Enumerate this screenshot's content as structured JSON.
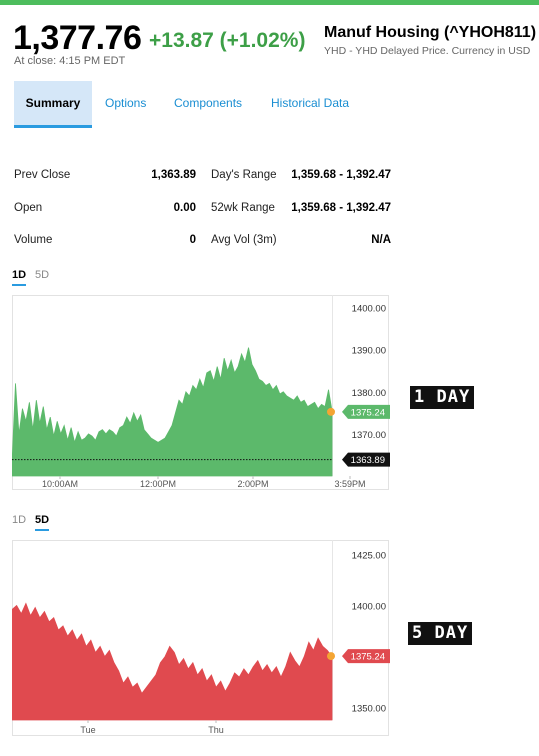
{
  "colors": {
    "topbar": "#4dbd5d",
    "positive": "#3d9f47",
    "area_1d": "#5cb96b",
    "area_5d": "#e04a4f",
    "accent": "#2a9be0",
    "marker": "#f4a533"
  },
  "quote": {
    "price": "1,377.76",
    "change": "+13.87 (+1.02%)",
    "close_time": "At close: 4:15 PM EDT",
    "name": "Manuf Housing (^YHOH811)",
    "subtitle": "YHD - YHD Delayed Price. Currency in USD"
  },
  "tabs": [
    {
      "label": "Summary",
      "active": true
    },
    {
      "label": "Options",
      "active": false
    },
    {
      "label": "Components",
      "active": false
    },
    {
      "label": "Historical Data",
      "active": false
    }
  ],
  "stats": [
    {
      "label": "Prev Close",
      "value": "1,363.89",
      "label2": "Day's Range",
      "value2": "1,359.68 - 1,392.47"
    },
    {
      "label": "Open",
      "value": "0.00",
      "label2": "52wk Range",
      "value2": "1,359.68 - 1,392.47"
    },
    {
      "label": "Volume",
      "value": "0",
      "label2": "Avg Vol (3m)",
      "value2": "N/A"
    }
  ],
  "chart1_tabs": [
    {
      "label": "1D",
      "active": true
    },
    {
      "label": "5D",
      "active": false
    }
  ],
  "chart2_tabs": [
    {
      "label": "1D",
      "active": false
    },
    {
      "label": "5D",
      "active": true
    }
  ],
  "badges": {
    "one_day": "1 DAY",
    "five_day": "5 DAY"
  },
  "chart_data": [
    {
      "type": "area",
      "period": "1D",
      "yticks": [
        "1400.00",
        "1390.00",
        "1380.00",
        "1370.00"
      ],
      "ylim": [
        1360,
        1403
      ],
      "xticks": [
        "10:00AM",
        "12:00PM",
        "2:00PM",
        "3:59PM"
      ],
      "last_price_label": "1375.24",
      "prev_close_label": "1363.89",
      "last_price": 1375.24,
      "prev_close": 1363.89,
      "values": [
        1363.0,
        1382.0,
        1370.0,
        1376.0,
        1373.0,
        1377.5,
        1371.0,
        1378.0,
        1372.5,
        1376.5,
        1371.0,
        1374.0,
        1369.5,
        1373.0,
        1370.0,
        1372.0,
        1368.5,
        1371.5,
        1368.0,
        1370.5,
        1368.5,
        1369.0,
        1370.0,
        1369.5,
        1368.5,
        1370.5,
        1371.0,
        1370.0,
        1371.0,
        1370.5,
        1369.5,
        1371.5,
        1372.0,
        1374.0,
        1372.5,
        1375.0,
        1373.0,
        1374.5,
        1371.0,
        1370.0,
        1369.0,
        1368.5,
        1368.0,
        1368.5,
        1369.0,
        1370.5,
        1372.0,
        1375.0,
        1378.0,
        1377.0,
        1380.0,
        1379.0,
        1381.5,
        1380.5,
        1383.0,
        1381.0,
        1384.5,
        1385.0,
        1382.5,
        1386.0,
        1383.0,
        1388.0,
        1385.0,
        1387.5,
        1384.5,
        1386.0,
        1389.0,
        1387.0,
        1390.5,
        1386.5,
        1385.0,
        1383.0,
        1382.5,
        1381.5,
        1382.0,
        1380.5,
        1381.5,
        1379.5,
        1380.0,
        1379.0,
        1378.5,
        1378.0,
        1379.0,
        1377.5,
        1378.0,
        1376.5,
        1377.0,
        1377.5,
        1376.0,
        1377.0,
        1376.5,
        1380.5,
        1375.5
      ]
    },
    {
      "type": "area",
      "period": "5D",
      "yticks": [
        "1425.00",
        "1400.00",
        "1375.00",
        "1350.00"
      ],
      "ylim": [
        1344,
        1432
      ],
      "xticks": [
        "Tue",
        "Thu"
      ],
      "last_price_label": "1375.24",
      "last_price": 1375.24,
      "values": [
        1398.0,
        1400.0,
        1396.0,
        1401.0,
        1395.0,
        1399.0,
        1394.0,
        1397.0,
        1392.0,
        1394.0,
        1388.0,
        1390.0,
        1385.0,
        1388.0,
        1383.0,
        1386.0,
        1380.0,
        1383.0,
        1377.0,
        1380.0,
        1375.0,
        1378.0,
        1372.0,
        1368.0,
        1362.0,
        1365.0,
        1360.0,
        1362.0,
        1357.0,
        1360.0,
        1363.0,
        1366.0,
        1372.0,
        1375.0,
        1380.0,
        1377.0,
        1371.0,
        1374.0,
        1369.0,
        1372.0,
        1366.0,
        1369.0,
        1363.0,
        1366.0,
        1360.0,
        1363.0,
        1358.0,
        1362.0,
        1367.0,
        1365.0,
        1369.0,
        1366.0,
        1370.0,
        1373.0,
        1368.0,
        1371.0,
        1367.0,
        1370.0,
        1365.0,
        1370.0,
        1377.0,
        1373.0,
        1370.0,
        1375.0,
        1382.0,
        1378.0,
        1384.0,
        1380.0,
        1378.0,
        1375.0
      ]
    }
  ]
}
